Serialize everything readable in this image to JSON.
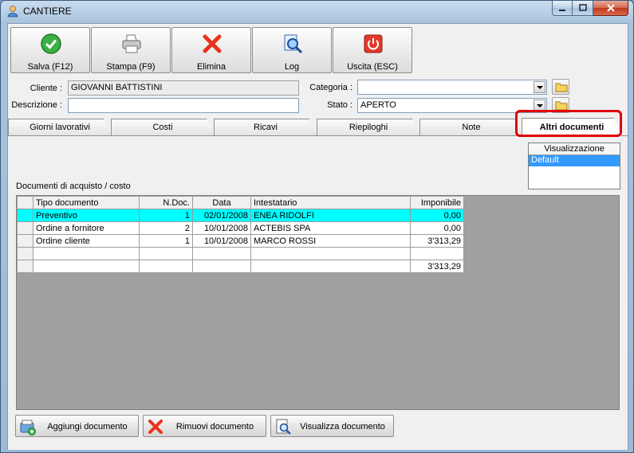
{
  "window": {
    "title": "CANTIERE"
  },
  "toolbar": {
    "save_label": "Salva (F12)",
    "print_label": "Stampa (F9)",
    "delete_label": "Elimina",
    "log_label": "Log",
    "exit_label": "Uscita (ESC)"
  },
  "form": {
    "cliente_label": "Cliente :",
    "cliente_value": "GIOVANNI BATTISTINI",
    "descrizione_label": "Descrizione :",
    "descrizione_value": "",
    "categoria_label": "Categoria :",
    "categoria_value": "",
    "stato_label": "Stato :",
    "stato_value": "APERTO"
  },
  "tabs": [
    {
      "label": "Giorni lavorativi"
    },
    {
      "label": "Costi"
    },
    {
      "label": "Ricavi"
    },
    {
      "label": "Riepiloghi"
    },
    {
      "label": "Note"
    },
    {
      "label": "Altri documenti"
    }
  ],
  "visualizzazione": {
    "header": "Visualizzazione",
    "selected": "Default"
  },
  "grid": {
    "caption": "Documenti di acquisto / costo",
    "columns": [
      "Tipo documento",
      "N.Doc.",
      "Data",
      "Intestatario",
      "Imponibile"
    ],
    "rows": [
      [
        "Preventivo",
        "1",
        "02/01/2008",
        "ENEA RIDOLFI",
        "0,00"
      ],
      [
        "Ordine a fornitore",
        "2",
        "10/01/2008",
        "ACTEBIS SPA",
        "0,00"
      ],
      [
        "Ordine cliente",
        "1",
        "10/01/2008",
        "MARCO ROSSI",
        "3'313,29"
      ]
    ],
    "total": "3'313,29"
  },
  "bottom": {
    "add_label": "Aggiungi documento",
    "remove_label": "Rimuovi documento",
    "view_label": "Visualizza documento"
  },
  "colors": {
    "selected_row": "#00ffff",
    "highlight": "#e00000",
    "list_selection": "#3399ff"
  }
}
